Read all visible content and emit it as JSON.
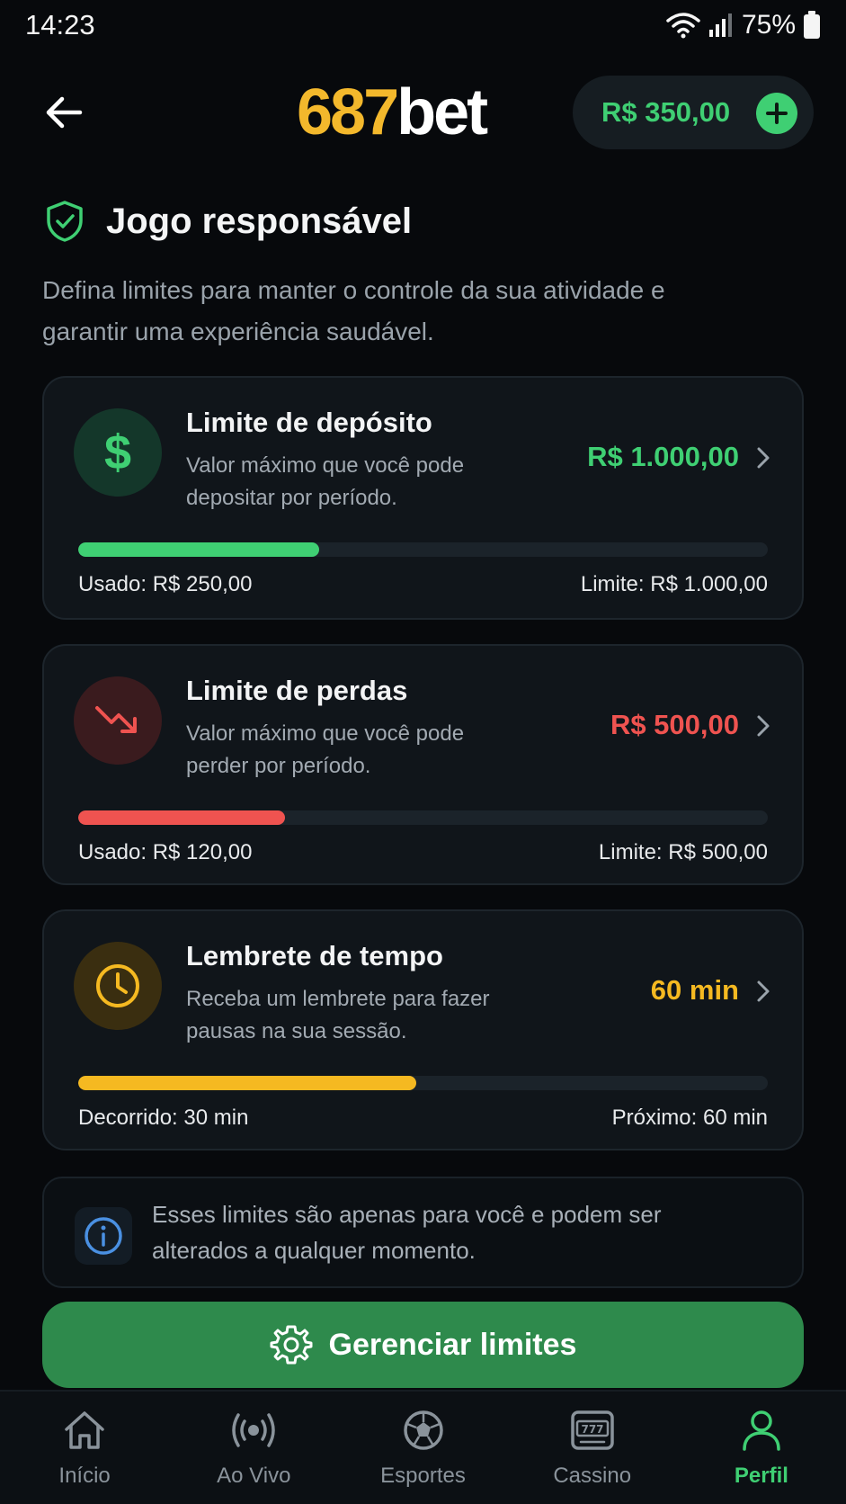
{
  "status_bar": {
    "time": "14:23",
    "battery": "75%"
  },
  "header": {
    "logo_number": "687",
    "logo_text": "bet",
    "balance": "R$ 350,00"
  },
  "page": {
    "title": "Jogo responsável",
    "description": "Defina limites para manter o controle da sua atividade e garantir uma experiência saudável."
  },
  "cards": [
    {
      "title": "Limite de depósito",
      "subtitle": "Valor máximo que você pode depositar por período.",
      "value": "R$ 1.000,00",
      "progress": 0.35,
      "color": "#3fcf73",
      "icon": "dollar-icon",
      "used": "Usado: R$ 250,00",
      "limit": "Limite: R$ 1.000,00"
    },
    {
      "title": "Limite de perdas",
      "subtitle": "Valor máximo que você pode perder por período.",
      "value": "R$ 500,00",
      "progress": 0.3,
      "color": "#ef5350",
      "icon": "trending-down-icon",
      "used": "Usado: R$ 120,00",
      "limit": "Limite: R$ 500,00"
    },
    {
      "title": "Lembrete de tempo",
      "subtitle": "Receba um lembrete para fazer pausas na sua sessão.",
      "value": "60 min",
      "progress": 0.49,
      "color": "#f5b921",
      "icon": "clock-icon",
      "used": "Decorrido: 30 min",
      "limit": "Próximo: 60 min"
    }
  ],
  "info": {
    "text": "Esses limites são apenas para você e podem ser alterados a qualquer momento."
  },
  "cta": {
    "label": "Gerenciar limites"
  },
  "nav": [
    {
      "label": "Início",
      "icon": "home-icon"
    },
    {
      "label": "Ao Vivo",
      "icon": "live-icon"
    },
    {
      "label": "Esportes",
      "icon": "soccer-ball-icon"
    },
    {
      "label": "Cassino",
      "icon": "slot-machine-icon"
    },
    {
      "label": "Perfil",
      "icon": "user-icon",
      "active": true
    }
  ],
  "colors": {
    "accent": "#3fcf73",
    "cta": "#2e8a4c",
    "danger": "#ef5350",
    "warning": "#f5b921"
  }
}
